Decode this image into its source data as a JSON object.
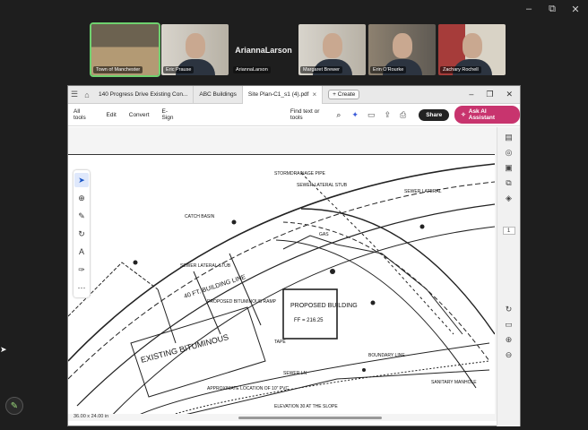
{
  "window_controls": {
    "minimize": "–",
    "restore": "⧉",
    "close": "✕"
  },
  "participants": [
    {
      "name": "Town of Manchester",
      "active": true,
      "bg": "room"
    },
    {
      "name": "Eric Prause",
      "active": false,
      "bg": "wall-white"
    },
    {
      "name": "AriannaLarson",
      "active": false,
      "bg": "none",
      "big_label": "AriannaLarson"
    },
    {
      "name": "Margaret Brewer",
      "active": false,
      "bg": "wall-white"
    },
    {
      "name": "Erin O'Rourke",
      "active": false,
      "bg": "wall-dark"
    },
    {
      "name": "Zachary Rochell",
      "active": false,
      "bg": "wall-red"
    }
  ],
  "acrobat": {
    "tabs": [
      {
        "label": "140 Progress Drive Existing Con...",
        "active": false
      },
      {
        "label": "ABC Buildings",
        "active": false
      },
      {
        "label": "Site Plan-C1_s1 (4).pdf",
        "active": true
      }
    ],
    "new_tab": "+ Create",
    "menu": [
      "All tools",
      "Edit",
      "Convert",
      "E-Sign"
    ],
    "find_placeholder": "Find text or tools",
    "share_label": "Share",
    "ai_label": "Ask AI Assistant",
    "page_number": "1",
    "status_size": "36.00 x 24.00 in"
  },
  "drawing_labels": {
    "existing": "EXISTING BITUMINOUS",
    "proposed_building": "PROPOSED BUILDING",
    "ff": "FF = 216.25",
    "building_line": "40 FT. BUILDING LINE",
    "sewer_lateral": "SEWER LATERAL",
    "catch_basin": "CATCH BASIN",
    "sewer_lateral_stub": "SEWER LATERAL STUB",
    "stormdrain": "STORMDRAINAGE PIPE",
    "sewer_manhole": "SANITARY MANHOLE",
    "approx": "APPROXIMATE LOCATION OF 10\" PVC",
    "proposed_bump": "PROPOSED BITUMINOUS RAMP",
    "gas": "GAS",
    "sewer_ln": "SEWER LN",
    "sewer_stub_left": "SEWER LATERAL STUB",
    "tape": "TAPE",
    "boundary": "BOUNDARY LINE",
    "no_parking": "ELEVATION 30 AT THE SLOPE"
  }
}
